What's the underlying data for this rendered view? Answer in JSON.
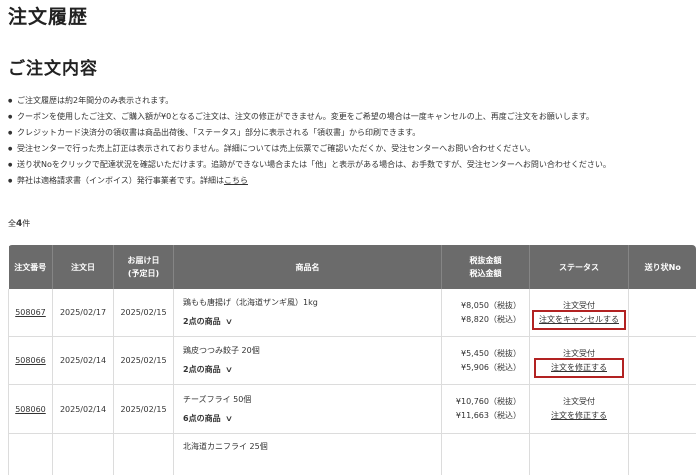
{
  "page_title": "注文履歴",
  "section_title": "ご注文内容",
  "notes": [
    {
      "text": "ご注文履歴は約2年間分のみ表示されます。"
    },
    {
      "text": "クーポンを使用したご注文、ご購入額が¥0となるご注文は、注文の修正ができません。変更をご希望の場合は一度キャンセルの上、再度ご注文をお願いします。"
    },
    {
      "text": "クレジットカード決済分の領収書は商品出荷後、「ステータス」部分に表示される「領収書」から印刷できます。"
    },
    {
      "text": "受注センターで行った売上訂正は表示されておりません。詳細については売上伝票でご確認いただくか、受注センターへお問い合わせください。"
    },
    {
      "text": "送り状Noをクリックで配達状況を確認いただけます。追跡ができない場合または「他」と表示がある場合は、お手数ですが、受注センターへお問い合わせください。"
    },
    {
      "text": "弊社は適格請求書（インボイス）発行事業者です。詳細は",
      "link": "こちら"
    }
  ],
  "count": {
    "prefix": "全",
    "number": "4",
    "suffix": "件"
  },
  "table": {
    "headers": {
      "order_no": "注文番号",
      "order_date": "注文日",
      "delivery_line1": "お届け日",
      "delivery_line2": "(予定日)",
      "product": "商品名",
      "amount_line1": "税抜金額",
      "amount_line2": "税込金額",
      "status": "ステータス",
      "tracking": "送り状No"
    },
    "rows": [
      {
        "order_no": "508067",
        "order_date": "2025/02/17",
        "delivery_date": "2025/02/15",
        "product_name": "鶏もも唐揚げ（北海道ザンギ風）1kg",
        "item_count": "2点の商品",
        "price_excl": "¥8,050（税抜）",
        "price_incl": "¥8,820（税込）",
        "status": "注文受付",
        "action": "注文をキャンセルする",
        "tracking": ""
      },
      {
        "order_no": "508066",
        "order_date": "2025/02/14",
        "delivery_date": "2025/02/15",
        "product_name": "鶏皮つつみ餃子 20個",
        "item_count": "2点の商品",
        "price_excl": "¥5,450（税抜）",
        "price_incl": "¥5,906（税込）",
        "status": "注文受付",
        "action": "注文を修正する",
        "tracking": ""
      },
      {
        "order_no": "508060",
        "order_date": "2025/02/14",
        "delivery_date": "2025/02/15",
        "product_name": "チーズフライ 50個",
        "item_count": "6点の商品",
        "price_excl": "¥10,760（税抜）",
        "price_incl": "¥11,663（税込）",
        "status": "注文受付",
        "action": "注文を修正する",
        "tracking": ""
      },
      {
        "order_no": "",
        "order_date": "",
        "delivery_date": "",
        "product_name": "北海道カニフライ 25個",
        "item_count": "",
        "price_excl": "",
        "price_incl": "",
        "status": "",
        "action": "",
        "tracking": ""
      }
    ]
  },
  "colors": {
    "header_bg": "#6b6b6b",
    "highlight_border": "#b22222"
  }
}
